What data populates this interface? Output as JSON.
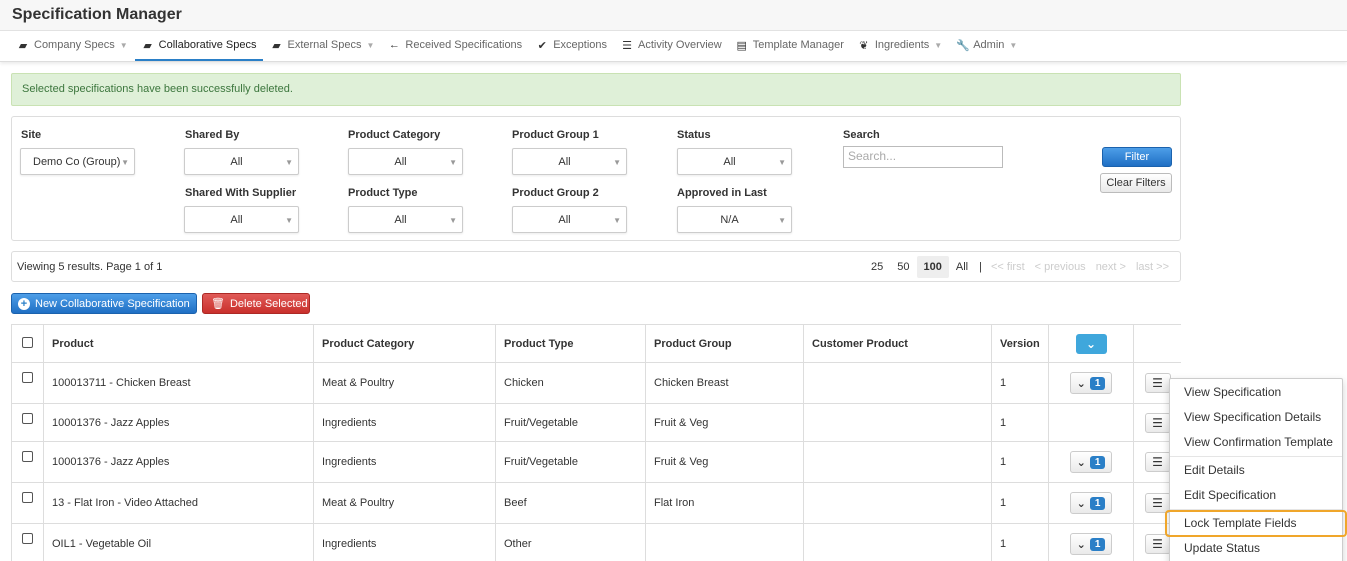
{
  "app": {
    "title": "Specification Manager"
  },
  "nav": {
    "items": [
      {
        "label": "Company Specs",
        "icon": "briefcase-icon",
        "glyph": "▰",
        "caret": true,
        "active": false
      },
      {
        "label": "Collaborative Specs",
        "icon": "briefcase-icon",
        "glyph": "▰",
        "caret": false,
        "active": true
      },
      {
        "label": "External Specs",
        "icon": "briefcase-icon",
        "glyph": "▰",
        "caret": true,
        "active": false
      },
      {
        "label": "Received Specifications",
        "icon": "arrow-left-icon",
        "glyph": "←",
        "caret": false,
        "active": false
      },
      {
        "label": "Exceptions",
        "icon": "check-circle-icon",
        "glyph": "✔",
        "caret": false,
        "active": false
      },
      {
        "label": "Activity Overview",
        "icon": "list-icon",
        "glyph": "☰",
        "caret": false,
        "active": false
      },
      {
        "label": "Template Manager",
        "icon": "template-icon",
        "glyph": "▤",
        "caret": false,
        "active": false
      },
      {
        "label": "Ingredients",
        "icon": "leaf-icon",
        "glyph": "❦",
        "caret": true,
        "active": false
      },
      {
        "label": "Admin",
        "icon": "wrench-icon",
        "glyph": "🔧",
        "caret": true,
        "active": false
      }
    ]
  },
  "alert": {
    "message": "Selected specifications have been successfully deleted."
  },
  "filters": {
    "site": {
      "label": "Site",
      "value": "Demo Co (Group)"
    },
    "shared_by": {
      "label": "Shared By",
      "value": "All"
    },
    "product_category": {
      "label": "Product Category",
      "value": "All"
    },
    "product_group_1": {
      "label": "Product Group 1",
      "value": "All"
    },
    "status": {
      "label": "Status",
      "value": "All"
    },
    "search": {
      "label": "Search",
      "placeholder": "Search..."
    },
    "shared_with_supplier": {
      "label": "Shared With Supplier",
      "value": "All"
    },
    "product_type": {
      "label": "Product Type",
      "value": "All"
    },
    "product_group_2": {
      "label": "Product Group 2",
      "value": "All"
    },
    "approved_in_last": {
      "label": "Approved in Last",
      "value": "N/A"
    },
    "filter_button": "Filter",
    "clear_button": "Clear Filters"
  },
  "pager": {
    "summary": "Viewing 5 results. Page 1 of 1",
    "sizes": [
      "25",
      "50",
      "100",
      "All"
    ],
    "selected_size": "100",
    "separator": "|",
    "first": "<< first",
    "previous": "< previous",
    "next": "next >",
    "last": "last >>"
  },
  "actions": {
    "new_label": "New Collaborative Specification",
    "delete_label": "Delete Selected"
  },
  "table": {
    "columns": [
      "Product",
      "Product Category",
      "Product Type",
      "Product Group",
      "Customer Product",
      "Version"
    ],
    "rows": [
      {
        "product": "100013711 - Chicken Breast",
        "category": "Meat & Poultry",
        "type": "Chicken",
        "group": "Chicken Breast",
        "customer": "",
        "version": "1",
        "badge": "1",
        "has_versions": true
      },
      {
        "product": "10001376 - Jazz Apples",
        "category": "Ingredients",
        "type": "Fruit/Vegetable",
        "group": "Fruit & Veg",
        "customer": "",
        "version": "1",
        "badge": "",
        "has_versions": false
      },
      {
        "product": "10001376 - Jazz Apples",
        "category": "Ingredients",
        "type": "Fruit/Vegetable",
        "group": "Fruit & Veg",
        "customer": "",
        "version": "1",
        "badge": "1",
        "has_versions": true
      },
      {
        "product": "13 - Flat Iron - Video Attached",
        "category": "Meat & Poultry",
        "type": "Beef",
        "group": "Flat Iron",
        "customer": "",
        "version": "1",
        "badge": "1",
        "has_versions": true
      },
      {
        "product": "OIL1 - Vegetable Oil",
        "category": "Ingredients",
        "type": "Other",
        "group": "",
        "customer": "",
        "version": "1",
        "badge": "1",
        "has_versions": true
      }
    ]
  },
  "dropdown": {
    "items": [
      "View Specification",
      "View Specification Details",
      "View Confirmation Template",
      "Edit Details",
      "Edit Specification",
      "Lock Template Fields",
      "Update Status"
    ],
    "highlighted": "Lock Template Fields",
    "highlight_color": "#f0a62a"
  }
}
